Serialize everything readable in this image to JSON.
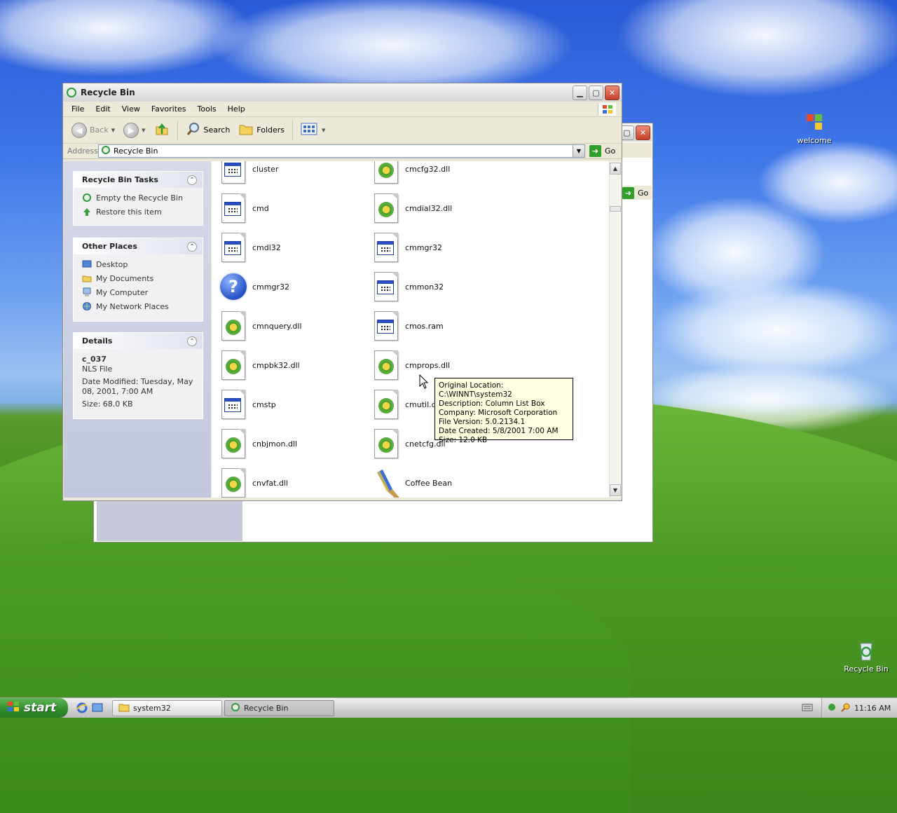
{
  "desktop": {
    "icons": [
      {
        "label": "welcome"
      },
      {
        "label": "Recycle Bin"
      }
    ]
  },
  "back_window": {
    "go_label": "Go"
  },
  "window": {
    "title": "Recycle Bin",
    "menu": [
      "File",
      "Edit",
      "View",
      "Favorites",
      "Tools",
      "Help"
    ],
    "toolbar": {
      "back_label": "Back",
      "search_label": "Search",
      "folders_label": "Folders"
    },
    "address": {
      "label": "Address",
      "value": "Recycle Bin",
      "go_label": "Go"
    },
    "tasks": {
      "title": "Recycle Bin Tasks",
      "items": [
        "Empty the Recycle Bin",
        "Restore this item"
      ]
    },
    "other_places": {
      "title": "Other Places",
      "items": [
        "Desktop",
        "My Documents",
        "My Computer",
        "My Network Places"
      ]
    },
    "details": {
      "title": "Details",
      "name": "c_037",
      "type": "NLS File",
      "modified": "Date Modified: Tuesday, May 08, 2001, 7:00 AM",
      "size": "Size: 68.0 KB"
    },
    "files": [
      {
        "name": "cluster",
        "icon": "app"
      },
      {
        "name": "cmcfg32.dll",
        "icon": "dll"
      },
      {
        "name": "cmd",
        "icon": "app"
      },
      {
        "name": "cmdial32.dll",
        "icon": "dll"
      },
      {
        "name": "cmdl32",
        "icon": "app"
      },
      {
        "name": "cmmgr32",
        "icon": "app"
      },
      {
        "name": "cmmgr32",
        "icon": "help"
      },
      {
        "name": "cmmon32",
        "icon": "app"
      },
      {
        "name": "cmnquery.dll",
        "icon": "dll"
      },
      {
        "name": "cmos.ram",
        "icon": "app"
      },
      {
        "name": "cmpbk32.dll",
        "icon": "dll"
      },
      {
        "name": "cmprops.dll",
        "icon": "dll"
      },
      {
        "name": "cmstp",
        "icon": "app"
      },
      {
        "name": "cmutil.dll",
        "icon": "dll"
      },
      {
        "name": "cnbjmon.dll",
        "icon": "dll"
      },
      {
        "name": "cnetcfg.dll",
        "icon": "dll"
      },
      {
        "name": "cnvfat.dll",
        "icon": "dll"
      },
      {
        "name": "Coffee Bean",
        "icon": "brush"
      }
    ],
    "tooltip": [
      "Original Location: C:\\WINNT\\system32",
      "Description: Column List Box",
      "Company: Microsoft Corporation",
      "File Version: 5.0.2134.1",
      "Date Created: 5/8/2001 7:00 AM",
      "Size: 12.0 KB"
    ]
  },
  "taskbar": {
    "start_label": "start",
    "tasks": [
      {
        "label": "system32"
      },
      {
        "label": "Recycle Bin"
      }
    ],
    "clock": "11:16 AM"
  },
  "colors": {
    "xp_green": "#2e8b2a",
    "tooltip_bg": "#ffffe1"
  }
}
